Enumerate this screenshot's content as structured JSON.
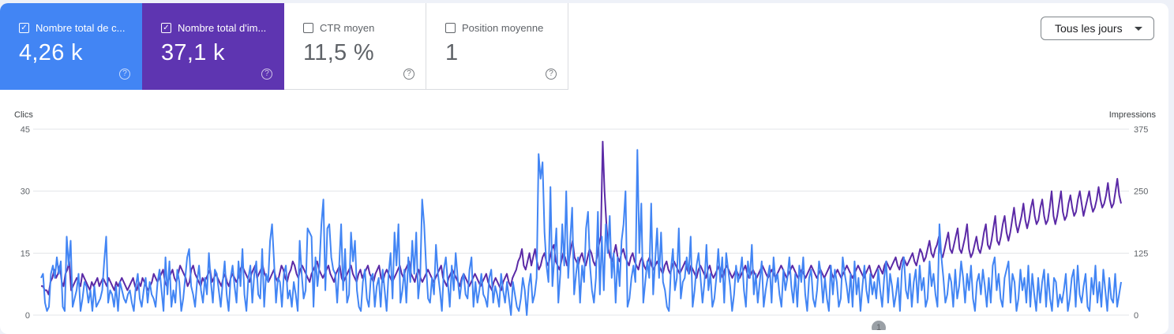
{
  "colors": {
    "clicks": "#4285f4",
    "impressions": "#5e35b1",
    "clicks_line": "#4285f4",
    "impressions_line": "#5b2aa6"
  },
  "metrics": [
    {
      "key": "clicks",
      "label": "Nombre total de c...",
      "value": "4,26 k",
      "checked": true,
      "check": "✓",
      "help": "?"
    },
    {
      "key": "impressions",
      "label": "Nombre total d'im...",
      "value": "37,1 k",
      "checked": true,
      "check": "✓",
      "help": "?"
    },
    {
      "key": "ctr",
      "label": "CTR moyen",
      "value": "11,5 %",
      "checked": false,
      "check": "",
      "help": "?"
    },
    {
      "key": "position",
      "label": "Position moyenne",
      "value": "1",
      "checked": false,
      "check": "",
      "help": "?"
    }
  ],
  "range_select": {
    "label": "Tous les jours"
  },
  "annotation_marker": "1",
  "chart_data": {
    "type": "line",
    "y_left": {
      "label": "Clics",
      "ticks": [
        0,
        15,
        30,
        45
      ],
      "ylim": [
        0,
        45
      ]
    },
    "y_right": {
      "label": "Impressions",
      "ticks": [
        0,
        125,
        250,
        375
      ],
      "ylim": [
        0,
        375
      ]
    },
    "grid": true,
    "series": [
      {
        "axis": "left",
        "values": [
          9,
          10,
          3,
          1,
          2,
          10,
          12,
          9,
          14,
          10,
          13,
          2,
          1,
          19,
          12,
          18,
          2,
          4,
          6,
          10,
          1,
          4,
          8,
          7,
          3,
          6,
          1,
          7,
          2,
          3,
          4,
          6,
          13,
          19,
          3,
          6,
          5,
          2,
          7,
          1,
          8,
          6,
          4,
          3,
          5,
          6,
          3,
          1,
          7,
          10,
          4,
          2,
          6,
          9,
          3,
          8,
          5,
          4,
          2,
          8,
          11,
          6,
          1,
          14,
          5,
          13,
          2,
          6,
          3,
          11,
          8,
          1,
          4,
          9,
          14,
          16,
          7,
          5,
          2,
          8,
          12,
          6,
          3,
          9,
          5,
          15,
          8,
          3,
          11,
          10,
          6,
          2,
          8,
          13,
          5,
          1,
          9,
          12,
          7,
          3,
          13,
          7,
          16,
          5,
          1,
          9,
          12,
          3,
          10,
          13,
          5,
          4,
          16,
          2,
          10,
          8,
          18,
          22,
          13,
          3,
          9,
          8,
          2,
          10,
          12,
          4,
          6,
          2,
          8,
          5,
          1,
          18,
          10,
          4,
          6,
          21,
          20,
          19,
          2,
          14,
          7,
          12,
          22,
          28,
          6,
          21,
          22,
          14,
          11,
          10,
          3,
          12,
          22,
          6,
          16,
          3,
          5,
          20,
          13,
          18,
          6,
          2,
          1,
          8,
          11,
          4,
          2,
          9,
          10,
          2,
          7,
          9,
          2,
          11,
          6,
          1,
          10,
          15,
          4,
          20,
          12,
          22,
          3,
          6,
          11,
          3,
          14,
          8,
          18,
          10,
          20,
          4,
          9,
          28,
          22,
          12,
          4,
          3,
          9,
          5,
          17,
          10,
          6,
          1,
          11,
          14,
          8,
          2,
          12,
          6,
          15,
          9,
          4,
          8,
          10,
          5,
          4,
          11,
          14,
          2,
          8,
          3,
          6,
          10,
          5,
          4,
          2,
          9,
          11,
          3,
          7,
          5,
          2,
          10,
          6,
          3,
          8,
          4,
          0,
          8,
          5,
          2,
          1,
          4,
          9,
          6,
          0,
          7,
          10,
          3,
          5,
          9,
          39,
          33,
          37,
          20,
          12,
          8,
          31,
          7,
          14,
          21,
          3,
          10,
          22,
          12,
          30,
          9,
          18,
          26,
          5,
          10,
          14,
          3,
          12,
          8,
          21,
          25,
          12,
          6,
          3,
          9,
          25,
          5,
          19,
          6,
          22,
          15,
          24,
          9,
          15,
          3,
          14,
          7,
          18,
          22,
          30,
          2,
          4,
          9,
          12,
          8,
          40,
          15,
          27,
          3,
          8,
          13,
          9,
          27,
          5,
          13,
          21,
          9,
          20,
          8,
          6,
          2,
          1,
          11,
          16,
          6,
          9,
          21,
          4,
          8,
          9,
          14,
          10,
          19,
          2,
          6,
          12,
          15,
          9,
          3,
          8,
          17,
          6,
          10,
          2,
          4,
          9,
          16,
          8,
          14,
          3,
          15,
          11,
          7,
          1,
          5,
          12,
          8,
          10,
          14,
          6,
          2,
          13,
          9,
          17,
          5,
          10,
          3,
          8,
          13,
          2,
          6,
          9,
          12,
          3,
          14,
          8,
          10,
          5,
          2,
          11,
          6,
          9,
          14,
          7,
          3,
          10,
          2,
          12,
          8,
          14,
          5,
          1,
          9,
          11,
          4,
          2,
          6,
          13,
          10,
          3,
          9,
          4,
          1,
          12,
          5,
          11,
          8,
          2,
          4,
          14,
          10,
          7,
          3,
          10,
          2,
          13,
          5,
          9,
          1,
          7,
          12,
          6,
          3,
          10,
          5,
          8,
          4,
          11,
          6,
          2,
          9,
          13,
          3,
          10,
          7,
          2,
          5,
          9,
          1,
          11,
          14,
          6,
          4,
          10,
          2,
          8,
          11,
          3,
          12,
          6,
          9,
          2,
          4,
          13,
          7,
          10,
          5,
          2,
          22,
          14,
          9,
          3,
          5,
          10,
          8,
          2,
          11,
          4,
          7,
          13,
          9,
          3,
          10,
          6,
          12,
          4,
          1,
          8,
          10,
          5,
          11,
          7,
          2,
          9,
          3,
          12,
          14,
          6,
          10,
          4,
          2,
          9,
          11,
          13,
          3,
          10,
          8,
          1,
          4,
          11,
          6,
          9,
          3,
          12,
          2,
          10,
          5,
          1,
          9,
          3,
          8,
          11,
          2,
          10,
          4,
          1,
          9,
          8,
          2,
          5,
          3,
          6,
          10,
          1,
          4,
          9,
          11,
          2,
          12,
          5,
          3,
          7,
          10,
          2,
          1,
          9,
          5,
          12,
          3,
          8,
          2,
          11,
          6,
          1,
          9,
          4,
          3,
          10,
          2,
          5,
          8
        ]
      },
      {
        "axis": "left",
        "values": [
          7,
          7,
          6,
          6,
          5,
          8,
          9,
          11,
          9,
          10,
          12,
          8,
          7,
          10,
          11,
          13,
          6,
          7,
          8,
          9,
          8,
          7,
          10,
          9,
          8,
          7,
          6,
          8,
          7,
          8,
          9,
          7,
          8,
          9,
          8,
          7,
          9,
          8,
          7,
          6,
          8,
          7,
          8,
          9,
          8,
          7,
          6,
          7,
          8,
          9,
          7,
          6,
          8,
          7,
          9,
          8,
          7,
          6,
          7,
          8,
          10,
          9,
          8,
          9,
          10,
          11,
          8,
          7,
          9,
          10,
          11,
          9,
          8,
          10,
          12,
          11,
          10,
          9,
          7,
          8,
          11,
          12,
          10,
          9,
          8,
          7,
          9,
          8,
          9,
          10,
          11,
          8,
          9,
          10,
          9,
          8,
          7,
          9,
          10,
          8,
          7,
          9,
          10,
          9,
          8,
          9,
          11,
          12,
          11,
          10,
          9,
          8,
          10,
          11,
          12,
          9,
          10,
          11,
          12,
          10,
          9,
          8,
          9,
          10,
          11,
          9,
          8,
          10,
          12,
          11,
          9,
          8,
          10,
          11,
          13,
          12,
          10,
          9,
          11,
          12,
          11,
          10,
          9,
          8,
          10,
          11,
          12,
          13,
          11,
          10,
          9,
          10,
          11,
          12,
          10,
          9,
          8,
          10,
          11,
          12,
          9,
          8,
          9,
          10,
          11,
          12,
          10,
          9,
          8,
          10,
          11,
          9,
          10,
          11,
          12,
          10,
          9,
          8,
          10,
          11,
          12,
          9,
          8,
          10,
          11,
          10,
          9,
          8,
          9,
          10,
          11,
          12,
          10,
          9,
          11,
          12,
          13,
          10,
          9,
          8,
          10,
          11,
          9,
          8,
          9,
          10,
          11,
          10,
          9,
          8,
          9,
          10,
          11,
          12,
          9,
          8,
          7,
          9,
          10,
          11,
          10,
          9,
          8,
          7,
          9,
          10,
          9,
          8,
          7,
          8,
          9,
          10,
          9,
          8,
          7,
          8,
          9,
          10,
          8,
          7,
          6,
          8,
          9,
          8,
          7,
          6,
          8,
          9,
          10,
          8,
          7,
          9,
          10,
          11,
          13,
          14,
          16,
          12,
          11,
          13,
          15,
          12,
          14,
          16,
          13,
          11,
          12,
          14,
          15,
          13,
          12,
          14,
          16,
          17,
          13,
          12,
          11,
          13,
          15,
          14,
          12,
          13,
          16,
          18,
          14,
          13,
          12,
          14,
          15,
          13,
          12,
          14,
          16,
          15,
          13,
          12,
          14,
          17,
          19,
          42,
          30,
          22,
          16,
          14,
          13,
          15,
          17,
          14,
          13,
          15,
          16,
          14,
          13,
          12,
          14,
          15,
          13,
          12,
          11,
          13,
          14,
          12,
          11,
          13,
          14,
          12,
          11,
          12,
          13,
          12,
          11,
          10,
          12,
          13,
          11,
          10,
          12,
          13,
          12,
          11,
          10,
          11,
          12,
          13,
          11,
          10,
          12,
          11,
          10,
          9,
          11,
          12,
          11,
          10,
          9,
          11,
          12,
          10,
          9,
          10,
          11,
          12,
          10,
          9,
          11,
          12,
          11,
          10,
          9,
          10,
          11,
          10,
          9,
          10,
          11,
          12,
          10,
          9,
          10,
          11,
          10,
          9,
          10,
          11,
          12,
          11,
          10,
          9,
          10,
          11,
          10,
          9,
          10,
          11,
          12,
          11,
          10,
          9,
          10,
          11,
          12,
          11,
          10,
          9,
          10,
          11,
          10,
          9,
          10,
          11,
          12,
          11,
          10,
          9,
          10,
          11,
          10,
          9,
          10,
          11,
          12,
          10,
          9,
          10,
          11,
          10,
          9,
          10,
          11,
          12,
          11,
          10,
          9,
          10,
          11,
          12,
          11,
          10,
          9,
          10,
          11,
          12,
          10,
          9,
          10,
          11,
          12,
          11,
          10,
          12,
          13,
          12,
          11,
          12,
          13,
          14,
          12,
          11,
          13,
          14,
          13,
          12,
          13,
          14,
          15,
          13,
          12,
          14,
          16,
          15,
          13,
          14,
          16,
          18,
          15,
          14,
          16,
          17,
          19,
          15,
          14,
          16,
          18,
          20,
          16,
          15,
          17,
          19,
          21,
          16,
          15,
          17,
          19,
          22,
          16,
          14,
          15,
          17,
          19,
          16,
          15,
          17,
          20,
          22,
          17,
          16,
          18,
          21,
          24,
          18,
          17,
          19,
          22,
          24,
          20,
          18,
          20,
          23,
          26,
          22,
          20,
          22,
          24,
          27,
          23,
          21,
          23,
          26,
          28,
          24,
          22,
          23,
          26,
          28,
          24,
          22,
          23,
          26,
          30,
          24,
          22,
          24,
          27,
          30,
          25,
          23,
          24,
          27,
          29,
          26,
          24,
          25,
          28,
          30,
          27,
          24,
          26,
          28,
          30,
          27,
          25,
          26,
          28,
          31,
          28,
          26,
          27,
          29,
          32,
          28,
          26,
          27,
          30,
          33,
          29,
          27
        ]
      }
    ]
  }
}
